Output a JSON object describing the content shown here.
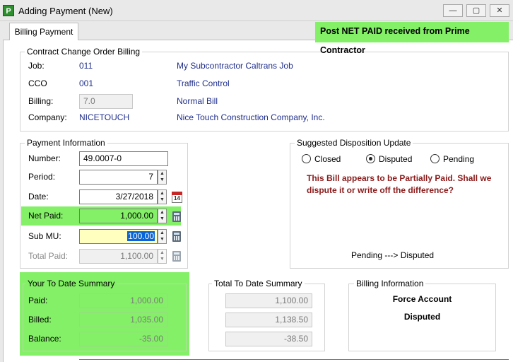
{
  "window": {
    "app_icon_letter": "P",
    "title": "Adding Payment  (New)",
    "minimize": "—",
    "maximize": "▢",
    "close": "✕"
  },
  "tabs": [
    {
      "label": "Billing Payment"
    }
  ],
  "banner": "Post NET PAID received from Prime Contractor",
  "contract": {
    "legend": "Contract Change Order Billing",
    "job_label": "Job:",
    "job_code": "011",
    "job_desc": "My Subcontractor Caltrans Job",
    "cco_label": "CCO",
    "cco_code": "001",
    "cco_desc": "Traffic Control",
    "billing_label": "Billing:",
    "billing_value": "7.0",
    "billing_desc": "Normal Bill",
    "company_label": "Company:",
    "company_code": "NICETOUCH",
    "company_desc": "Nice Touch Construction Company, Inc."
  },
  "payment": {
    "legend": "Payment Information",
    "number_label": "Number:",
    "number_value": "49.0007-0",
    "period_label": "Period:",
    "period_value": "7",
    "date_label": "Date:",
    "date_value": "3/27/2018",
    "calendar_day": "14",
    "net_paid_label": "Net Paid:",
    "net_paid_value": "1,000.00",
    "sub_mu_label": "Sub MU:",
    "sub_mu_value": "100.00",
    "total_paid_label": "Total Paid:",
    "total_paid_value": "1,100.00"
  },
  "disposition": {
    "legend": "Suggested Disposition Update",
    "options": [
      {
        "label": "Closed",
        "selected": false
      },
      {
        "label": "Disputed",
        "selected": true
      },
      {
        "label": "Pending",
        "selected": false
      }
    ],
    "warning": "This Bill appears to be Partially Paid. Shall we dispute it or write off the difference?",
    "transition": "Pending ---> Disputed"
  },
  "your_summary": {
    "legend": "Your To Date Summary",
    "paid_label": "Paid:",
    "paid_value": "1,000.00",
    "billed_label": "Billed:",
    "billed_value": "1,035.00",
    "balance_label": "Balance:",
    "balance_value": "-35.00"
  },
  "total_summary": {
    "legend": "Total To Date Summary",
    "paid_value": "1,100.00",
    "billed_value": "1,138.50",
    "balance_value": "-38.50"
  },
  "billing_info": {
    "legend": "Billing Information",
    "line1": "Force Account",
    "line2": "Disputed"
  },
  "colors": {
    "highlight_green": "#84f067",
    "link_blue": "#1f2e8c",
    "warning_red": "#8b1a1a",
    "edit_yellow": "#ffffc0"
  }
}
